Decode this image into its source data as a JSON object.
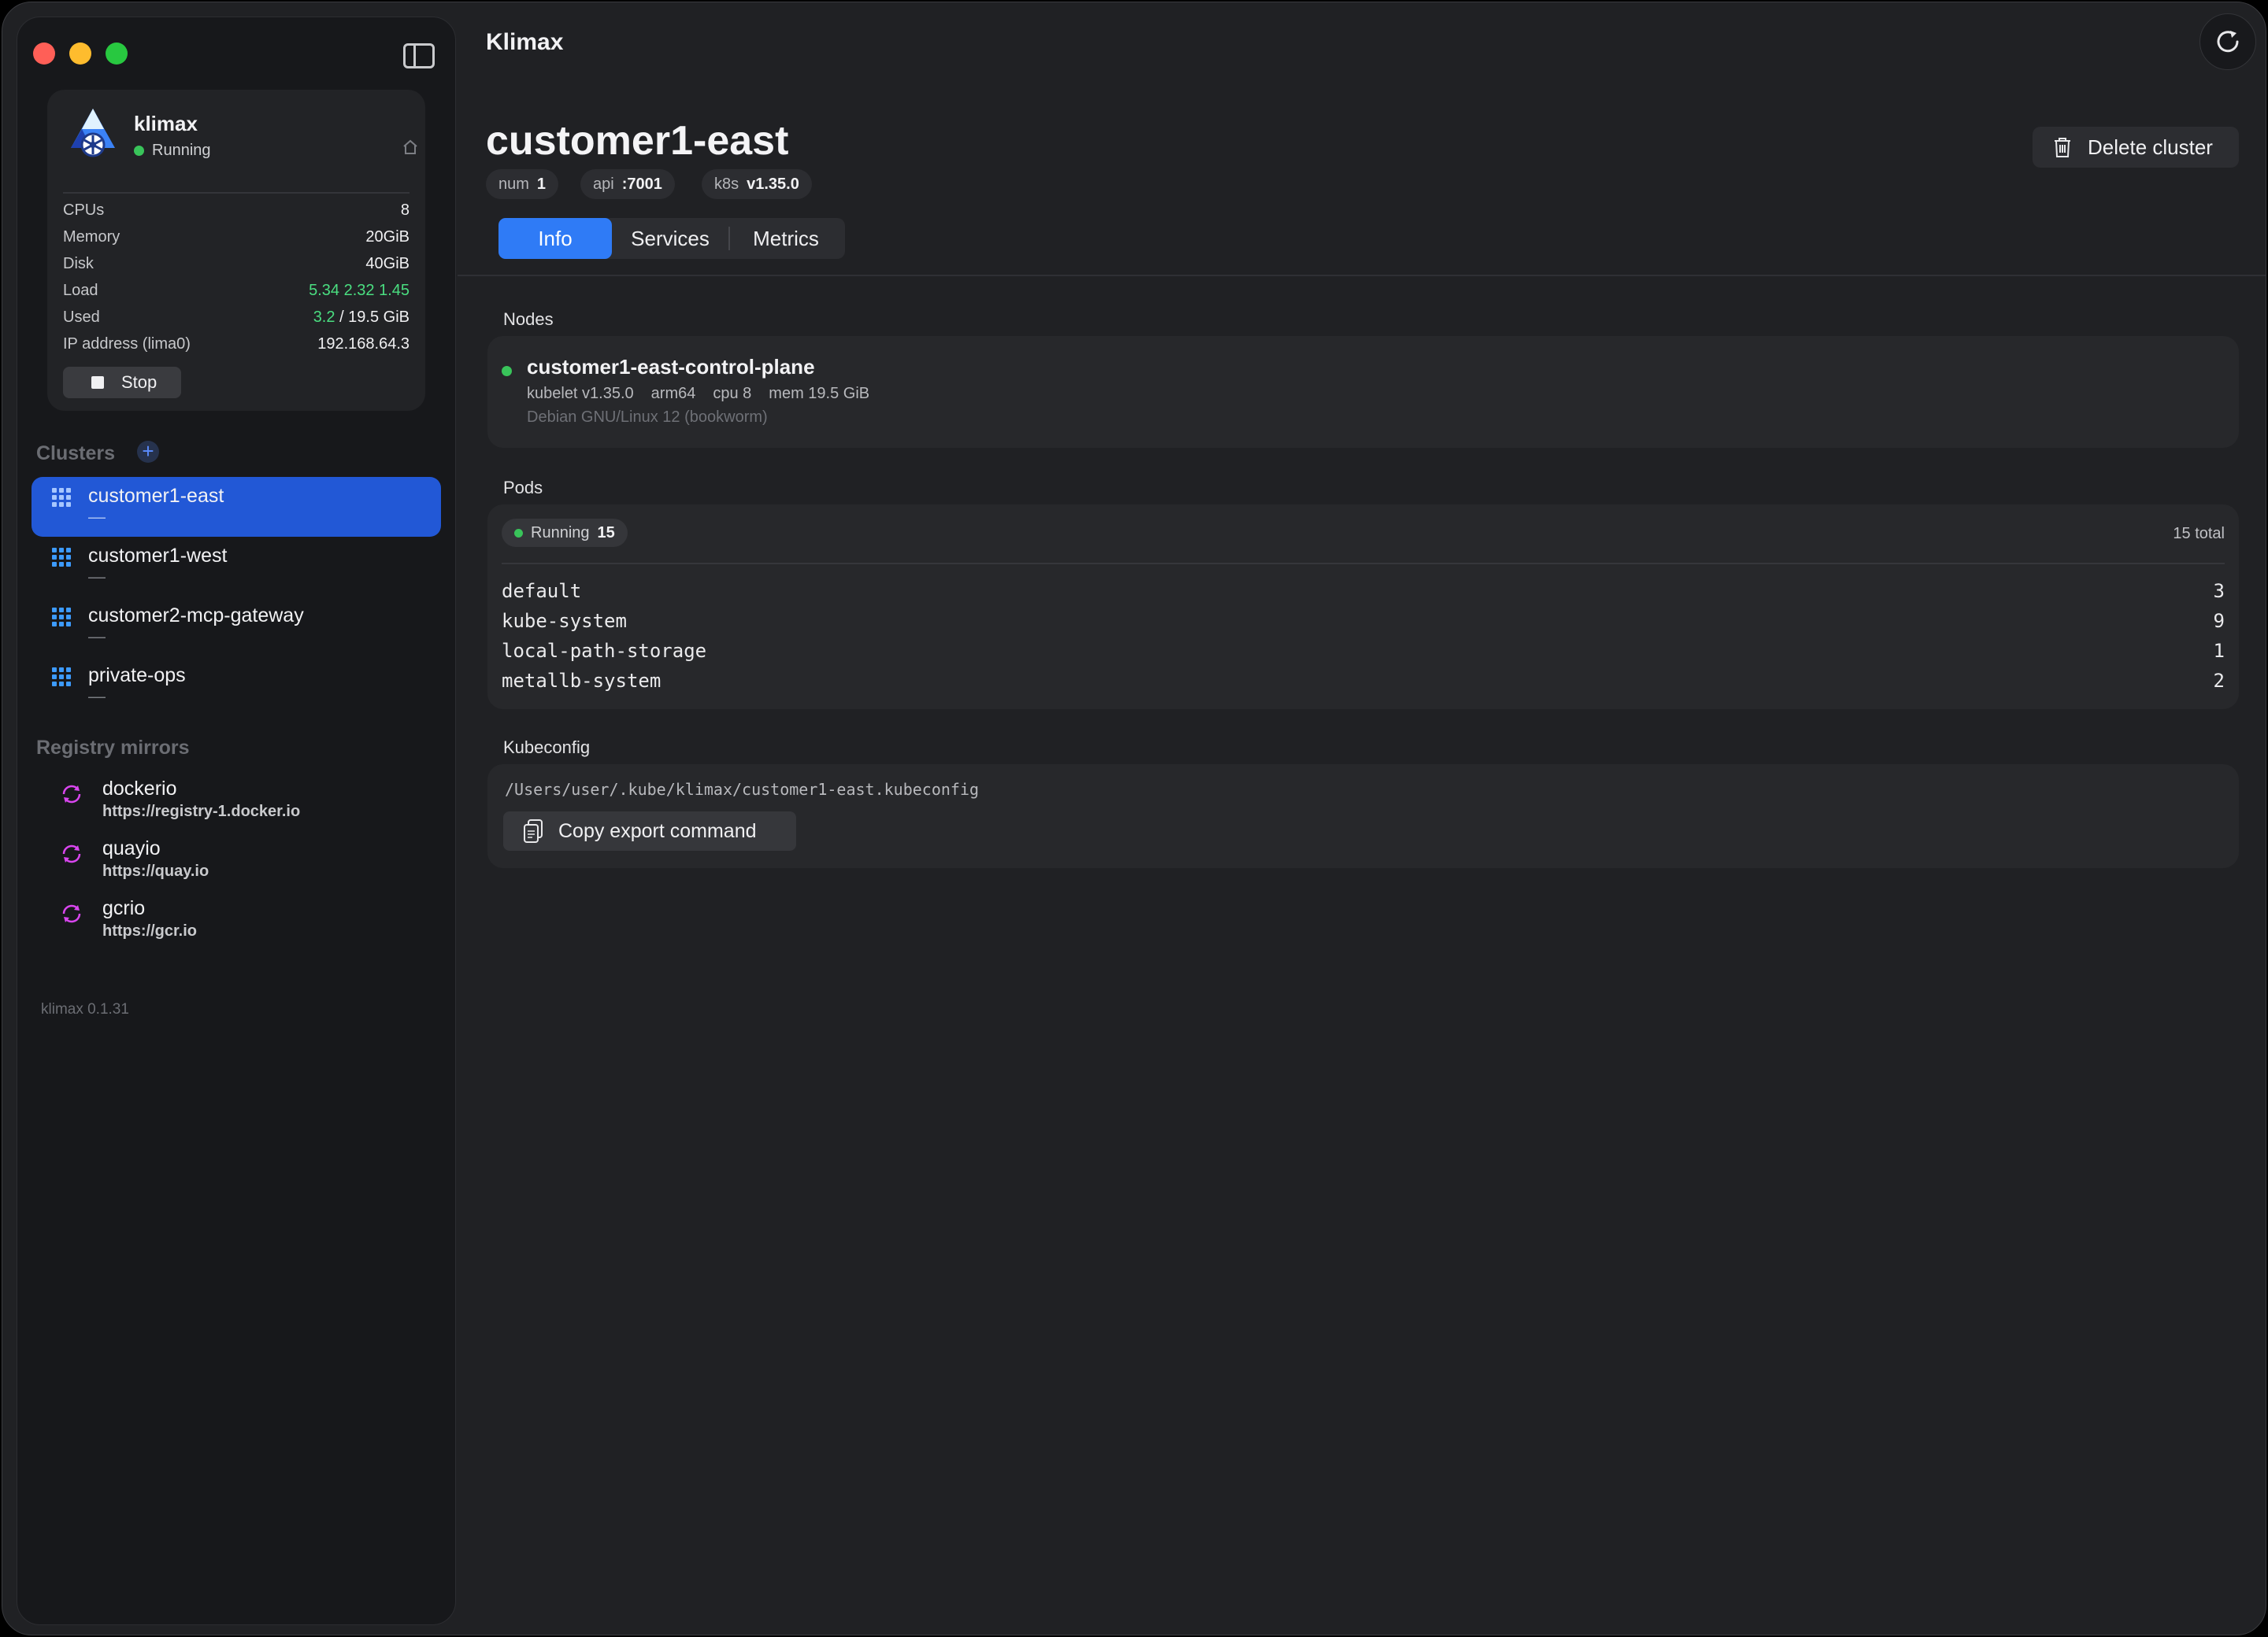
{
  "app": {
    "title": "Klimax"
  },
  "vm": {
    "name": "klimax",
    "status": "Running",
    "stats": [
      {
        "label": "CPUs",
        "value": "8"
      },
      {
        "label": "Memory",
        "value": "20GiB"
      },
      {
        "label": "Disk",
        "value": "40GiB"
      },
      {
        "label": "Load",
        "value": "5.34 2.32 1.45"
      },
      {
        "label": "Used",
        "value_used": "3.2",
        "value_total": "/ 19.5 GiB"
      },
      {
        "label": "IP address (lima0)",
        "value": "192.168.64.3"
      }
    ],
    "stop_label": "Stop"
  },
  "sidebar": {
    "clusters_title": "Clusters",
    "clusters": [
      {
        "name": "customer1-east",
        "sub": "—"
      },
      {
        "name": "customer1-west",
        "sub": "—"
      },
      {
        "name": "customer2-mcp-gateway",
        "sub": "—"
      },
      {
        "name": "private-ops",
        "sub": "—"
      }
    ],
    "mirrors_title": "Registry mirrors",
    "mirrors": [
      {
        "name": "dockerio",
        "url": "https://registry-1.docker.io"
      },
      {
        "name": "quayio",
        "url": "https://quay.io"
      },
      {
        "name": "gcrio",
        "url": "https://gcr.io"
      }
    ],
    "version": "klimax 0.1.31"
  },
  "cluster": {
    "title": "customer1-east",
    "chips": [
      {
        "k": "num",
        "v": "1"
      },
      {
        "k": "api",
        "v": ":7001"
      },
      {
        "k": "k8s",
        "v": "v1.35.0"
      }
    ],
    "delete_label": "Delete cluster",
    "tabs": [
      "Info",
      "Services",
      "Metrics"
    ]
  },
  "nodes": {
    "label": "Nodes",
    "name": "customer1-east-control-plane",
    "meta": [
      "kubelet v1.35.0",
      "arm64",
      "cpu 8",
      "mem 19.5 GiB"
    ],
    "os": "Debian GNU/Linux 12 (bookworm)"
  },
  "pods": {
    "label": "Pods",
    "running_label": "Running",
    "running_count": "15",
    "total": "15 total",
    "namespaces": [
      {
        "name": "default",
        "count": "3"
      },
      {
        "name": "kube-system",
        "count": "9"
      },
      {
        "name": "local-path-storage",
        "count": "1"
      },
      {
        "name": "metallb-system",
        "count": "2"
      }
    ]
  },
  "kubeconfig": {
    "label": "Kubeconfig",
    "path": "/Users/user/.kube/klimax/customer1-east.kubeconfig",
    "copy_label": "Copy export command"
  },
  "colors": {
    "accent": "#2f7bf6",
    "sidebar_active": "#2258d6",
    "running": "#39c45a",
    "load_green": "#4ade80",
    "mirror_icon": "#d946ef"
  }
}
